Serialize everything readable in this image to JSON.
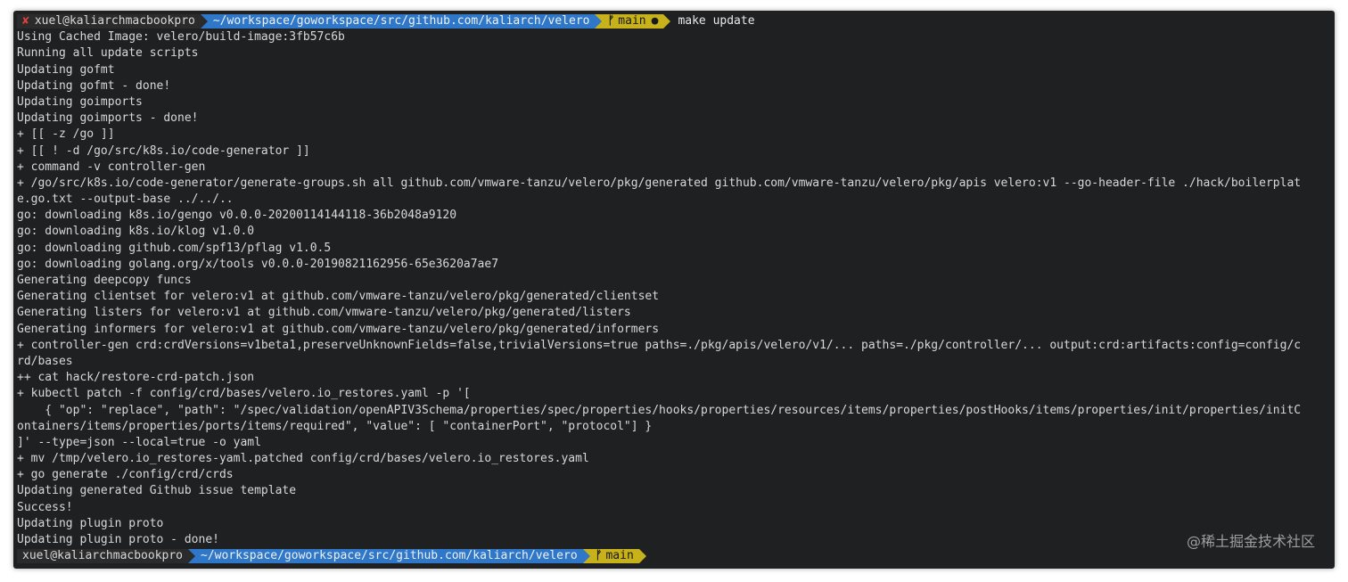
{
  "prompt_top": {
    "status_icon": "✘",
    "user_host": "xuel@kaliarchmacbookpro",
    "path": "~/workspace/goworkspace/src/github.com/kaliarch/velero",
    "branch_icon": "ᚠ",
    "branch": "main",
    "dirty_marker": "●",
    "command": "make update"
  },
  "output_lines": [
    "Using Cached Image: velero/build-image:3fb57c6b",
    "Running all update scripts",
    "Updating gofmt",
    "Updating gofmt - done!",
    "Updating goimports",
    "Updating goimports - done!",
    "+ [[ -z /go ]]",
    "+ [[ ! -d /go/src/k8s.io/code-generator ]]",
    "+ command -v controller-gen",
    "+ /go/src/k8s.io/code-generator/generate-groups.sh all github.com/vmware-tanzu/velero/pkg/generated github.com/vmware-tanzu/velero/pkg/apis velero:v1 --go-header-file ./hack/boilerplat",
    "e.go.txt --output-base ../../..",
    "go: downloading k8s.io/gengo v0.0.0-20200114144118-36b2048a9120",
    "go: downloading k8s.io/klog v1.0.0",
    "go: downloading github.com/spf13/pflag v1.0.5",
    "go: downloading golang.org/x/tools v0.0.0-20190821162956-65e3620a7ae7",
    "Generating deepcopy funcs",
    "Generating clientset for velero:v1 at github.com/vmware-tanzu/velero/pkg/generated/clientset",
    "Generating listers for velero:v1 at github.com/vmware-tanzu/velero/pkg/generated/listers",
    "Generating informers for velero:v1 at github.com/vmware-tanzu/velero/pkg/generated/informers",
    "+ controller-gen crd:crdVersions=v1beta1,preserveUnknownFields=false,trivialVersions=true paths=./pkg/apis/velero/v1/... paths=./pkg/controller/... output:crd:artifacts:config=config/c",
    "rd/bases",
    "++ cat hack/restore-crd-patch.json",
    "+ kubectl patch -f config/crd/bases/velero.io_restores.yaml -p '[",
    "    { \"op\": \"replace\", \"path\": \"/spec/validation/openAPIV3Schema/properties/spec/properties/hooks/properties/resources/items/properties/postHooks/items/properties/init/properties/initC",
    "ontainers/items/properties/ports/items/required\", \"value\": [ \"containerPort\", \"protocol\"] }",
    "]' --type=json --local=true -o yaml",
    "+ mv /tmp/velero.io_restores-yaml.patched config/crd/bases/velero.io_restores.yaml",
    "+ go generate ./config/crd/crds",
    "Updating generated Github issue template",
    "Success!",
    "Updating plugin proto",
    "Updating plugin proto - done!"
  ],
  "prompt_bottom": {
    "user_host": "xuel@kaliarchmacbookpro",
    "path": "~/workspace/goworkspace/src/github.com/kaliarch/velero",
    "branch_icon": "ᚠ",
    "branch": "main"
  },
  "watermark": "@稀土掘金技术社区",
  "colors": {
    "terminal_bg": "#1f2022",
    "text": "#d8d8d8",
    "path_segment": "#2f77c8",
    "git_segment": "#c8b21c",
    "error": "#e04040"
  }
}
